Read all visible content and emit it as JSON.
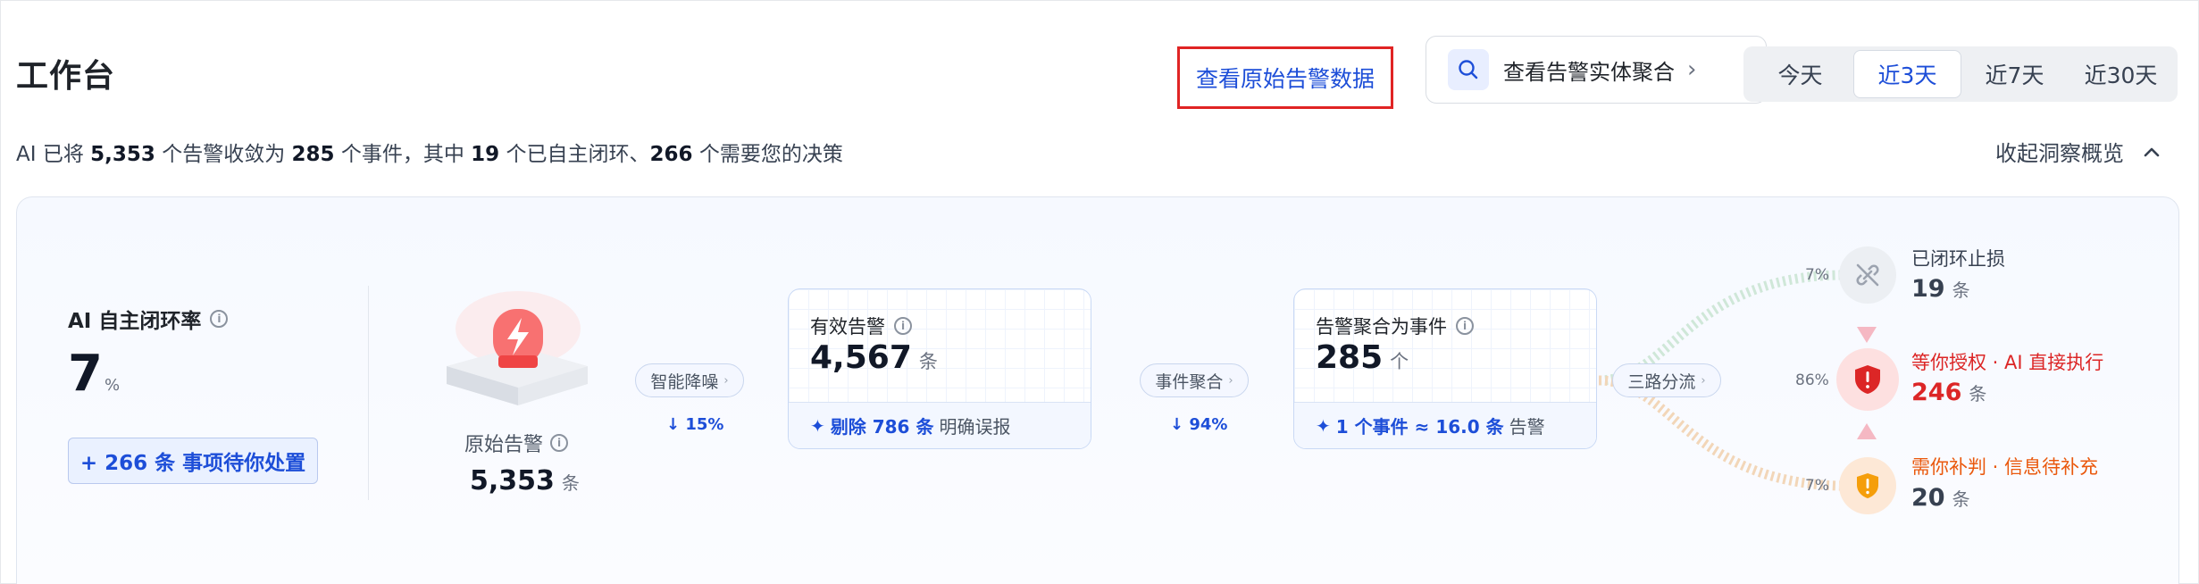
{
  "header": {
    "title": "工作台",
    "raw_alerts_link": "查看原始告警数据",
    "entity_button": "查看告警实体聚合",
    "time_ranges": [
      "今天",
      "近3天",
      "近7天",
      "近30天"
    ],
    "active_range": "近3天"
  },
  "summary": {
    "prefix": "AI 已将 ",
    "alerts": "5,353",
    "mid1": " 个告警收敛为 ",
    "events": "285",
    "mid2": " 个事件，其中 ",
    "closed": "19",
    "mid3": " 个已自主闭环、",
    "decisions": "266",
    "suffix": " 个需要您的决策",
    "collapse_label": "收起洞察概览"
  },
  "rate": {
    "title": "AI 自主闭环率",
    "value": "7",
    "unit": "%",
    "pending_label": "+ 266 条 事项待你处置"
  },
  "source": {
    "label": "原始告警",
    "value": "5,353",
    "unit": "条"
  },
  "steps": {
    "dedupe": {
      "label": "智能降噪",
      "pct": "↓ 15%"
    },
    "aggregate": {
      "label": "事件聚合",
      "pct": "↓ 94%"
    },
    "split": {
      "label": "三路分流"
    }
  },
  "effective": {
    "title": "有效告警",
    "value": "4,567",
    "unit": "条",
    "footer_bold": "剔除 786 条",
    "footer_text": "明确误报"
  },
  "events": {
    "title": "告警聚合为事件",
    "value": "285",
    "unit": "个",
    "footer_bold": "1 个事件 ≈ 16.0 条",
    "footer_text": "告警"
  },
  "outcomes": [
    {
      "label": "已闭环止损",
      "value": "19",
      "unit": "条",
      "pct": "7%",
      "color": "#374151",
      "icon": "link-off-icon"
    },
    {
      "label": "等你授权 · AI 直接执行",
      "value": "246",
      "unit": "条",
      "pct": "86%",
      "color": "#dc2626",
      "icon": "shield-alert-icon"
    },
    {
      "label": "需你补判 · 信息待补充",
      "value": "20",
      "unit": "条",
      "pct": "7%",
      "color": "#ea580c",
      "icon": "shield-warning-icon"
    }
  ],
  "colors": {
    "accent": "#1d4ed8",
    "danger": "#dc2626",
    "warning": "#ea580c"
  }
}
